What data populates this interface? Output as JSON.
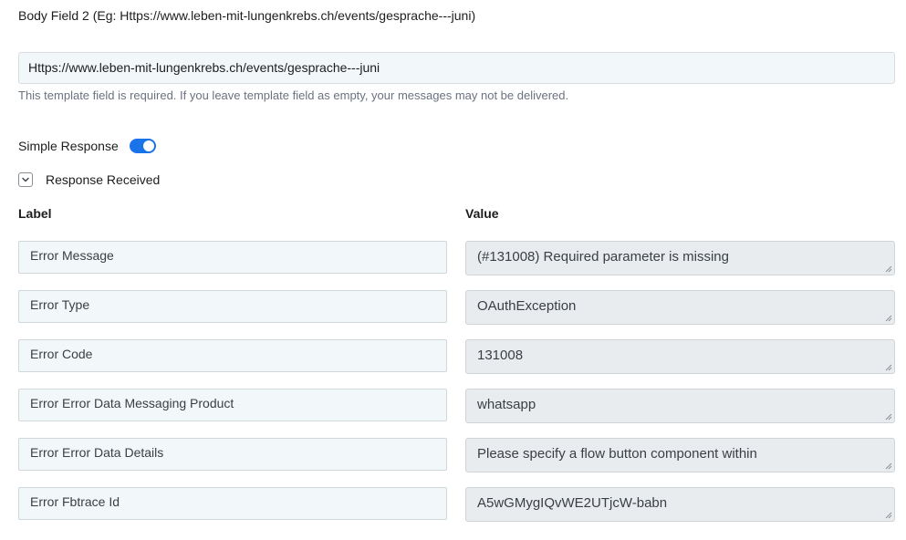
{
  "body_field": {
    "label": "Body Field 2 (Eg: Https://www.leben-mit-lungenkrebs.ch/events/gesprache---juni)",
    "value": "Https://www.leben-mit-lungenkrebs.ch/events/gesprache---juni",
    "hint": "This template field is required. If you leave template field as empty, your messages may not be delivered."
  },
  "simple_response": {
    "label": "Simple Response",
    "enabled": true
  },
  "response_received": {
    "label": "Response Received",
    "icon": "chevron-down-icon"
  },
  "columns": {
    "label": "Label",
    "value": "Value"
  },
  "rows": [
    {
      "label": "Error Message",
      "value": "(#131008) Required parameter is missing"
    },
    {
      "label": "Error Type",
      "value": "OAuthException"
    },
    {
      "label": "Error Code",
      "value": "131008"
    },
    {
      "label": "Error Error Data Messaging Product",
      "value": "whatsapp"
    },
    {
      "label": "Error Error Data Details",
      "value": "Please specify a flow button component within"
    },
    {
      "label": "Error Fbtrace Id",
      "value": "A5wGMygIQvWE2UTjcW-babn"
    }
  ],
  "colors": {
    "accent": "#1a73e8",
    "label_bg": "#f2f7f9",
    "value_bg": "#e9ecef"
  }
}
